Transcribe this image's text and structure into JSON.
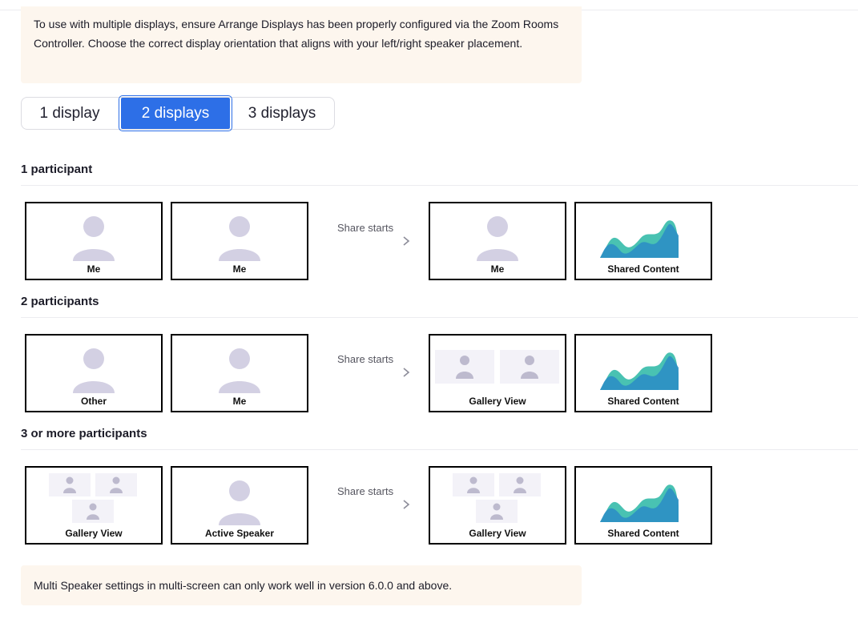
{
  "notices": {
    "top": "To use with multiple displays, ensure Arrange Displays has been properly configured via the Zoom Rooms Controller. Choose the correct display orientation that aligns with your left/right speaker placement.",
    "bottom": "Multi Speaker settings in multi-screen can only work well in version 6.0.0 and above."
  },
  "tabs": [
    {
      "label": "1 display",
      "selected": false
    },
    {
      "label": "2 displays",
      "selected": true
    },
    {
      "label": "3 displays",
      "selected": false
    }
  ],
  "colors": {
    "accent": "#2d6fe7",
    "notice_bg": "#fdf6ee",
    "avatar": "#d3d0e3",
    "chart_dark": "#2c8fc4",
    "chart_light": "#49c2b2"
  },
  "share_label": "Share starts",
  "sections": [
    {
      "title": "1 participant",
      "before": [
        {
          "caption": "Me",
          "icon": "person-icon"
        },
        {
          "caption": "Me",
          "icon": "person-icon"
        }
      ],
      "after": [
        {
          "caption": "Me",
          "icon": "person-icon"
        },
        {
          "caption": "Shared Content",
          "icon": "shared-content-chart-icon"
        }
      ]
    },
    {
      "title": "2 participants",
      "before": [
        {
          "caption": "Other",
          "icon": "person-icon"
        },
        {
          "caption": "Me",
          "icon": "person-icon"
        }
      ],
      "after": [
        {
          "caption": "Gallery View",
          "icon": "gallery-two-icon"
        },
        {
          "caption": "Shared Content",
          "icon": "shared-content-chart-icon"
        }
      ]
    },
    {
      "title": "3 or more participants",
      "before": [
        {
          "caption": "Gallery View",
          "icon": "gallery-three-icon"
        },
        {
          "caption": "Active Speaker",
          "icon": "person-icon"
        }
      ],
      "after": [
        {
          "caption": "Gallery View",
          "icon": "gallery-three-icon"
        },
        {
          "caption": "Shared Content",
          "icon": "shared-content-chart-icon"
        }
      ]
    }
  ]
}
